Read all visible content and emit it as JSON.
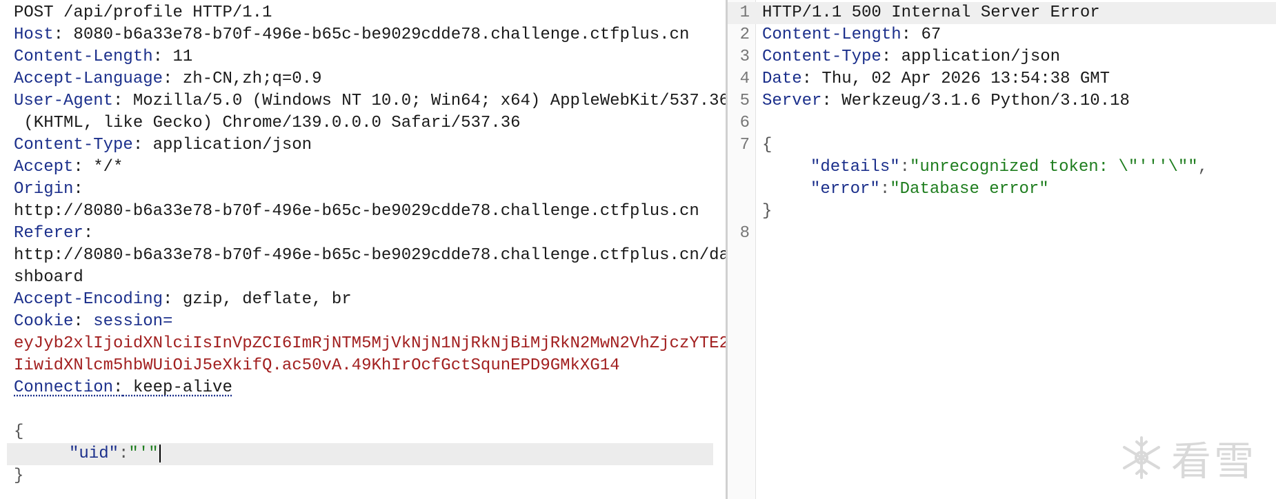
{
  "request": {
    "request_line": "POST /api/profile HTTP/1.1",
    "headers": [
      {
        "key": "Host",
        "value": " 8080-b6a33e78-b70f-496e-b65c-be9029cdde78.challenge.ctfplus.cn"
      },
      {
        "key": "Content-Length",
        "value": " 11"
      },
      {
        "key": "Accept-Language",
        "value": " zh-CN,zh;q=0.9"
      },
      {
        "key": "User-Agent",
        "value": " Mozilla/5.0 (Windows NT 10.0; Win64; x64) AppleWebKit/537.36",
        "cont": " (KHTML, like Gecko) Chrome/139.0.0.0 Safari/537.36"
      },
      {
        "key": "Content-Type",
        "value": " application/json"
      },
      {
        "key": "Accept",
        "value": " */*"
      },
      {
        "key": "Origin",
        "value": "",
        "cont": "http://8080-b6a33e78-b70f-496e-b65c-be9029cdde78.challenge.ctfplus.cn"
      },
      {
        "key": "Referer",
        "value": "",
        "cont": "http://8080-b6a33e78-b70f-496e-b65c-be9029cdde78.challenge.ctfplus.cn/da",
        "cont2": "shboard"
      },
      {
        "key": "Accept-Encoding",
        "value": " gzip, deflate, br"
      }
    ],
    "cookie": {
      "key": "Cookie",
      "name": " session",
      "eq": "=",
      "line1": "eyJyb2xlIjoidXNlciIsInVpZCI6ImRjNTM5MjVkNjN1NjRkNjBiMjRkN2MwN2VhZjczYTE2",
      "line2": "IiwidXNlcm5hbWUiOiJ5eXkifQ.ac50vA.49KhIrOcfGctSqunEPD9GMkXG14"
    },
    "connection": {
      "key": "Connection",
      "value": " keep-alive"
    },
    "body": {
      "open": "{",
      "key": "\"uid\"",
      "colon": ":",
      "value": "\"'\"",
      "close": "}"
    }
  },
  "response": {
    "lines": [
      {
        "num": "1",
        "status": "HTTP/1.1 500 Internal Server Error"
      },
      {
        "num": "2",
        "key": "Content-Length",
        "value": " 67"
      },
      {
        "num": "3",
        "key": "Content-Type",
        "value": " application/json"
      },
      {
        "num": "4",
        "key": "Date",
        "value": " Thu, 02 Apr 2026 13:54:38 GMT"
      },
      {
        "num": "5",
        "key": "Server",
        "value": " Werkzeug/3.1.6 Python/3.10.18"
      },
      {
        "num": "6"
      },
      {
        "num": "7",
        "text": "{"
      },
      {
        "num": "",
        "jkey": "\"details\"",
        "jval": "\"unrecognized token: \\\"'''\\\"\"",
        "tail": ","
      },
      {
        "num": "",
        "jkey": "\"error\"",
        "jval": "\"Database error\""
      },
      {
        "num": "",
        "text": "}"
      },
      {
        "num": "8"
      }
    ]
  },
  "watermark": {
    "text": "看雪",
    "icon": "snowflake-logo-icon"
  }
}
